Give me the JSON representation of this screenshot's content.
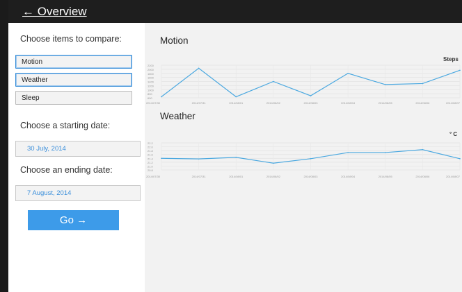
{
  "topbar": {
    "back_label": "← Overview"
  },
  "sidebar": {
    "items_heading": "Choose items to compare:",
    "items": [
      {
        "label": "Motion",
        "selected": true
      },
      {
        "label": "Weather",
        "selected": true
      },
      {
        "label": "Sleep",
        "selected": false
      }
    ],
    "start_heading": "Choose a starting date:",
    "start_value": "30 July, 2014",
    "end_heading": "Choose an ending date:",
    "end_value": "7 August, 2014",
    "go_label": "Go →"
  },
  "colors": {
    "accent": "#3d9be9",
    "line": "#4aa8e0",
    "topbar": "#1e1e1e"
  },
  "chart_data": [
    {
      "type": "line",
      "title": "Motion",
      "unit_label": "Steps",
      "categories": [
        "2014/07/30",
        "2014/07/31",
        "2014/08/01",
        "2014/08/02",
        "2014/08/03",
        "2014/08/04",
        "2014/08/05",
        "2014/08/06",
        "2014/08/07"
      ],
      "y_ticks": [
        "2200",
        "2000",
        "1800",
        "1600",
        "1400",
        "1200",
        "1000",
        "800",
        "600"
      ],
      "ylim": [
        600,
        2200
      ],
      "values": [
        650,
        2050,
        650,
        1400,
        700,
        1800,
        1250,
        1300,
        1950
      ],
      "grid": true
    },
    {
      "type": "line",
      "title": "Weather",
      "unit_label": "° C",
      "categories": [
        "2014/07/30",
        "2014/07/31",
        "2014/08/01",
        "2014/08/02",
        "2014/08/03",
        "2014/08/04",
        "2014/08/05",
        "2014/08/06",
        "2014/08/07"
      ],
      "y_ticks": [
        "22.2",
        "22.0",
        "21.8",
        "21.6",
        "21.4",
        "21.2",
        "21.0",
        "20.8"
      ],
      "ylim": [
        20.8,
        22.2
      ],
      "values": [
        21.4,
        21.37,
        21.45,
        21.15,
        21.38,
        21.7,
        21.7,
        21.85,
        21.38
      ],
      "grid": true
    }
  ]
}
